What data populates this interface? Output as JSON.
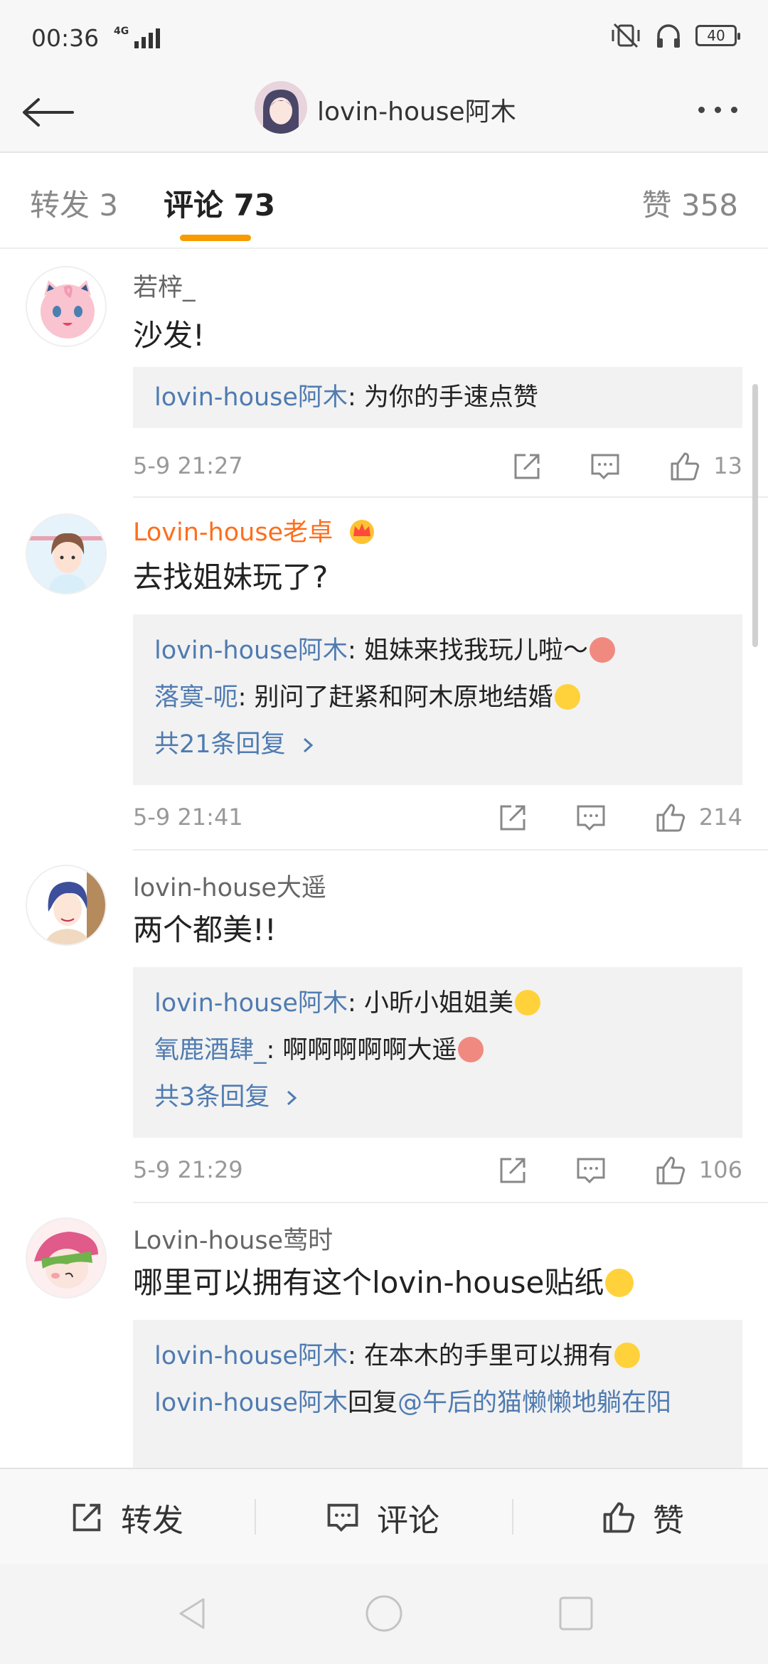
{
  "status_bar": {
    "time": "00:36",
    "network": "4G",
    "battery": "40"
  },
  "header": {
    "title": "lovin-house阿木"
  },
  "tabs": [
    {
      "label": "转发 3"
    },
    {
      "label": "评论 73"
    },
    {
      "label": "赞 358"
    }
  ],
  "comments": [
    {
      "author": "若梓_",
      "text": "沙发!",
      "replies": [
        {
          "name": "lovin-house阿木",
          "text": ": 为你的手速点赞"
        }
      ],
      "time": "5-9 21:27",
      "likes": "13"
    },
    {
      "author": "Lovin-house老卓",
      "text": "去找姐妹玩了?",
      "replies": [
        {
          "name": "lovin-house阿木",
          "text": ": 姐妹来找我玩儿啦～"
        },
        {
          "name": "落寞-呃",
          "text": ": 别问了赶紧和阿木原地结婚"
        }
      ],
      "more_replies": "共21条回复",
      "time": "5-9 21:41",
      "likes": "214"
    },
    {
      "author": "lovin-house大遥",
      "text": "两个都美!!",
      "replies": [
        {
          "name": "lovin-house阿木",
          "text": ": 小昕小姐姐美"
        },
        {
          "name": "氧鹿酒肆_",
          "text": ": 啊啊啊啊啊大遥"
        }
      ],
      "more_replies": "共3条回复",
      "time": "5-9 21:29",
      "likes": "106"
    },
    {
      "author": "Lovin-house莺时",
      "text": "哪里可以拥有这个lovin-house贴纸",
      "replies": [
        {
          "name": "lovin-house阿木",
          "text": ": 在本木的手里可以拥有"
        },
        {
          "name": "lovin-house阿木",
          "text": "回复",
          "mention": "@午后的猫懒懒地躺在阳"
        }
      ]
    }
  ],
  "toolbar": {
    "repost": "转发",
    "comment": "评论",
    "like": "赞"
  },
  "colors": {
    "accent": "#f79b00",
    "link": "#4f7bb1",
    "vip_name": "#ff6e1a"
  }
}
